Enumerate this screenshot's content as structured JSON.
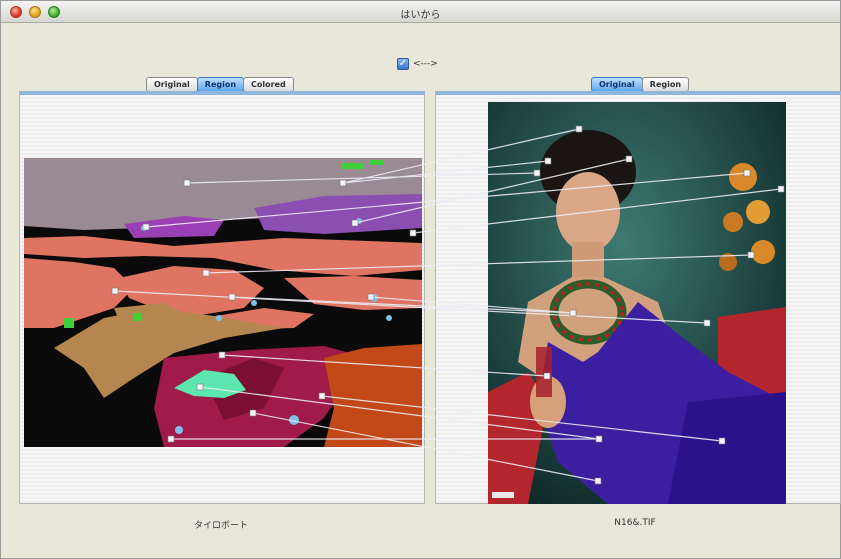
{
  "window": {
    "title": "はいから"
  },
  "sync": {
    "checked": true,
    "label": "<--->"
  },
  "left": {
    "tabs": [
      "Original",
      "Region",
      "Colored"
    ],
    "active_tab": "Region",
    "caption": "タイロボート"
  },
  "right": {
    "tabs": [
      "Original",
      "Region"
    ],
    "active_tab": "Original",
    "caption": "N16&.TIF",
    "photo_stamp": "FIF"
  },
  "icons": [
    "close-icon",
    "minimize-icon",
    "maximize-icon",
    "checkbox-checked-icon"
  ],
  "colors": {
    "tab_active": "#5ea7f0",
    "panel_border_accent": "#8fb6dc",
    "match_line": "#e8e8f0"
  }
}
